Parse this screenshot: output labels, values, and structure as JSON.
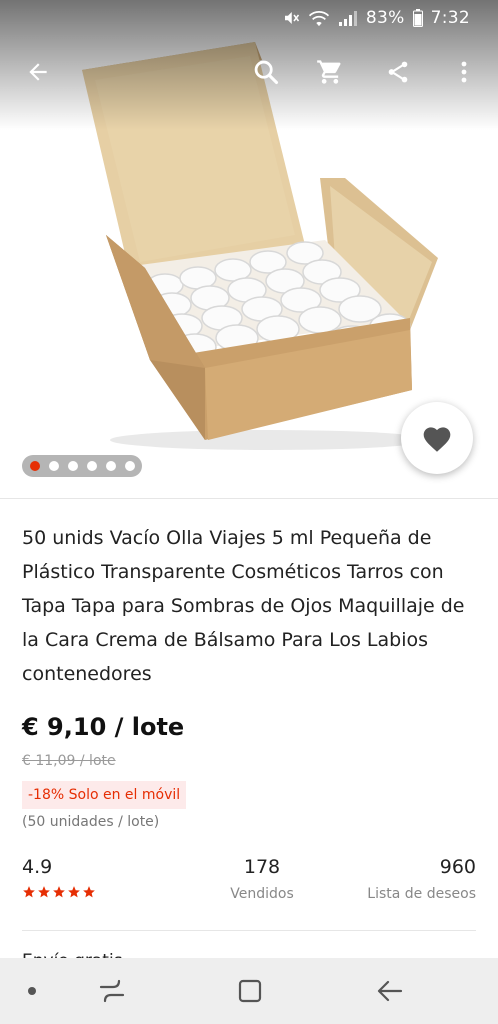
{
  "status_bar": {
    "battery": "83%",
    "time": "7:32",
    "icons": [
      "mute-icon",
      "wifi-icon",
      "signal-icon"
    ]
  },
  "toolbar": {
    "icons": [
      "back-arrow-icon",
      "search-icon",
      "cart-icon",
      "share-icon",
      "more-vert-icon"
    ]
  },
  "gallery": {
    "image_count": 6,
    "current_index": 1,
    "favorite_icon": "heart-icon"
  },
  "product": {
    "title": "50 unids Vacío Olla Viajes 5 ml Pequeña de Plástico Transparente Cosméticos Tarros con Tapa Tapa para Sombras de Ojos Maquillaje de la Cara Crema de Bálsamo Para Los Labios contenedores",
    "price": "€ 9,10 / lote",
    "original_price": "€ 11,09 / lote",
    "discount": "-18% Solo en el móvil",
    "lot_info": "(50 unidades / lote)"
  },
  "stats": {
    "rating": "4.9",
    "rating_stars": 5,
    "sold_count": "178",
    "sold_label": "Vendidos",
    "wishlist_count": "960",
    "wishlist_label": "Lista de deseos"
  },
  "next_section": {
    "peek_label": "Envío gratis"
  },
  "colors": {
    "accent": "#e62e04",
    "star": "#e62e04",
    "discount_bg": "#fdeaea"
  },
  "nav_bar": {
    "icons": [
      "nav-dot-icon",
      "recents-icon",
      "home-icon",
      "nav-back-icon"
    ]
  }
}
